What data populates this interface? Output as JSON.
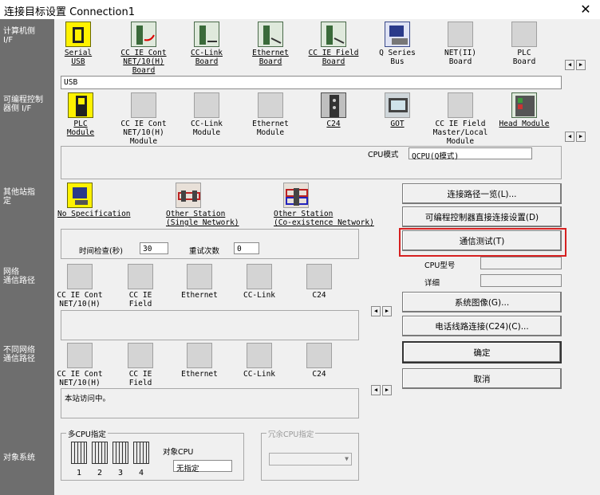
{
  "window": {
    "title": "连接目标设置 Connection1",
    "close": "✕"
  },
  "side_labels": {
    "pc_if": "计算机侧\nI/F",
    "plc_if": "可编程控制\n器侧 I/F",
    "other_station": "其他站指\n定",
    "network_route": "网络\n通信路径",
    "diff_network_route": "不同网络\n通信路径",
    "target_system": "对象系统"
  },
  "pc_side": {
    "items": [
      {
        "label": "Serial\nUSB",
        "icon": "usb-cable-icon"
      },
      {
        "label": "CC IE Cont\nNET/10(H)\nBoard",
        "icon": "board-icon"
      },
      {
        "label": "CC-Link\nBoard",
        "icon": "board-icon"
      },
      {
        "label": "Ethernet\nBoard",
        "icon": "board-icon"
      },
      {
        "label": "CC IE Field\nBoard",
        "icon": "board-icon"
      },
      {
        "label": "Q Series\nBus",
        "icon": "pc-icon"
      },
      {
        "label": "NET(II)\nBoard",
        "icon": "board-icon"
      },
      {
        "label": "PLC\nBoard",
        "icon": "board-icon"
      }
    ],
    "selected_text": "USB"
  },
  "plc_side": {
    "items": [
      {
        "label": "PLC\nModule",
        "icon": "plc-module-icon"
      },
      {
        "label": "CC IE Cont\nNET/10(H)\nModule",
        "icon": "module-icon"
      },
      {
        "label": "CC-Link\nModule",
        "icon": "module-icon"
      },
      {
        "label": "Ethernet\nModule",
        "icon": "module-icon"
      },
      {
        "label": "C24",
        "icon": "c24-icon"
      },
      {
        "label": "GOT",
        "icon": "got-icon"
      },
      {
        "label": "CC IE Field\nMaster/Local\nModule",
        "icon": "module-icon"
      },
      {
        "label": "Head Module",
        "icon": "head-module-icon"
      }
    ],
    "cpu_mode_label": "CPU模式",
    "cpu_mode_value": "QCPU(Q模式)"
  },
  "other_station": {
    "items": [
      {
        "label": "No Specification",
        "icon": "no-spec-icon"
      },
      {
        "label": "Other Station\n(Single Network)",
        "icon": "single-network-icon"
      },
      {
        "label": "Other Station\n(Co-existence Network)",
        "icon": "coexist-network-icon"
      }
    ],
    "time_check_label": "时间检查(秒)",
    "time_check_value": "30",
    "retry_label": "重试次数",
    "retry_value": "0"
  },
  "network_route": {
    "items": [
      {
        "label": "CC IE Cont\nNET/10(H)"
      },
      {
        "label": "CC IE\nField"
      },
      {
        "label": "Ethernet"
      },
      {
        "label": "CC-Link"
      },
      {
        "label": "C24"
      }
    ]
  },
  "diff_network_route": {
    "items": [
      {
        "label": "CC IE Cont\nNET/10(H)"
      },
      {
        "label": "CC IE\nField"
      },
      {
        "label": "Ethernet"
      },
      {
        "label": "CC-Link"
      },
      {
        "label": "C24"
      }
    ],
    "status_text": "本站访问中。"
  },
  "target_system": {
    "multi_cpu_label": "多CPU指定",
    "cpu_numbers": [
      "1",
      "2",
      "3",
      "4"
    ],
    "target_cpu_label": "对象CPU",
    "target_cpu_value": "无指定",
    "redundant_cpu_label": "冗余CPU指定"
  },
  "buttons": {
    "route_list": "连接路径一览(L)...",
    "direct_connect": "可编程控制器直接连接设置(D)",
    "comm_test": "通信测试(T)",
    "cpu_model_label": "CPU型号",
    "detail_label": "详细",
    "system_image": "系统图像(G)...",
    "phone_line": "电话线路连接(C24)(C)...",
    "ok": "确定",
    "cancel": "取消"
  },
  "colors": {
    "side_panel": "#6e6e6e",
    "highlight": "#d62020",
    "accent_yellow": "#fff200"
  }
}
